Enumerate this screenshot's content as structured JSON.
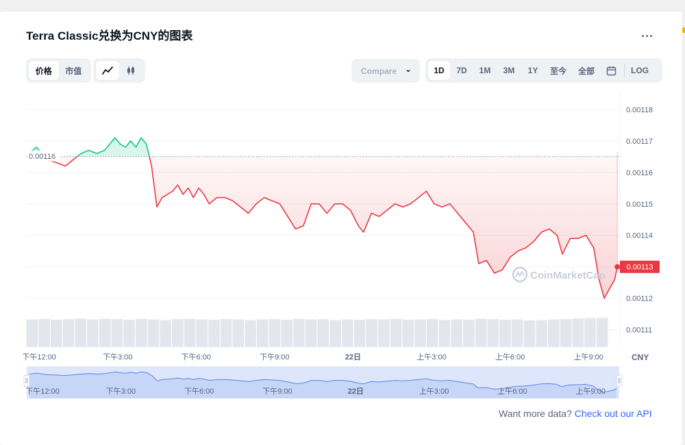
{
  "header": {
    "title": "Terra Classic兑换为CNY的图表",
    "more_label": "..."
  },
  "toolbar": {
    "view_tabs": [
      "价格",
      "市值"
    ],
    "chart_type_icons": [
      "line-chart-icon",
      "candlestick-icon"
    ],
    "compare_label": "Compare",
    "ranges": [
      "1D",
      "7D",
      "1M",
      "3M",
      "1Y",
      "至今",
      "全部"
    ],
    "active_range": "1D",
    "calendar_icon": "calendar-icon",
    "log_label": "LOG"
  },
  "watermark": "CoinMarketCap",
  "footer": {
    "text": "Want more data?",
    "link": "Check out our API"
  },
  "colors": {
    "up": "#16c784",
    "down": "#ea3943",
    "navigator": "#5b85e6"
  },
  "chart_data": {
    "type": "line",
    "currency_label": "CNY",
    "y_ticks": [
      "0.00118",
      "0.00117",
      "0.00116",
      "0.00115",
      "0.00114",
      "0.00113",
      "0.00112",
      "0.00111"
    ],
    "ylim": [
      0.0011045,
      0.001188
    ],
    "xlim": [
      0,
      22.7
    ],
    "x_ticks": [
      {
        "x": 0.5,
        "label": "下午12:00"
      },
      {
        "x": 3.5,
        "label": "下午3:00"
      },
      {
        "x": 6.5,
        "label": "下午6:00"
      },
      {
        "x": 9.5,
        "label": "下午9:00"
      },
      {
        "x": 12.5,
        "label": "22日"
      },
      {
        "x": 15.5,
        "label": "上午3:00"
      },
      {
        "x": 18.5,
        "label": "上午6:00"
      },
      {
        "x": 21.5,
        "label": "上午9:00"
      }
    ],
    "navigator_ticks": [
      "下午12:00",
      "下午3:00",
      "下午6:00",
      "下午9:00",
      "22日",
      "上午3:00",
      "上午6:00",
      "上午9:00"
    ],
    "open_price": 0.001165,
    "open_price_label": "0.00116",
    "current_price": 0.00113,
    "current_price_label": "0.00113",
    "series": [
      {
        "values": [
          [
            0.1,
            0.001166
          ],
          [
            0.4,
            0.001168
          ],
          [
            0.8,
            0.001164
          ],
          [
            1.2,
            0.001163
          ],
          [
            1.5,
            0.001162
          ],
          [
            1.8,
            0.001164
          ],
          [
            2.1,
            0.001166
          ],
          [
            2.4,
            0.001167
          ],
          [
            2.7,
            0.001166
          ],
          [
            3.0,
            0.001167
          ],
          [
            3.2,
            0.001169
          ],
          [
            3.4,
            0.001171
          ],
          [
            3.6,
            0.001169
          ],
          [
            3.8,
            0.001168
          ],
          [
            4.0,
            0.00117
          ],
          [
            4.2,
            0.001168
          ],
          [
            4.4,
            0.001171
          ],
          [
            4.6,
            0.001169
          ],
          [
            4.8,
            0.001162
          ],
          [
            5.0,
            0.001149
          ],
          [
            5.2,
            0.001152
          ],
          [
            5.4,
            0.001153
          ],
          [
            5.6,
            0.001154
          ],
          [
            5.8,
            0.001156
          ],
          [
            6.0,
            0.001153
          ],
          [
            6.2,
            0.001155
          ],
          [
            6.4,
            0.001152
          ],
          [
            6.6,
            0.001155
          ],
          [
            6.8,
            0.001153
          ],
          [
            7.0,
            0.00115
          ],
          [
            7.3,
            0.001152
          ],
          [
            7.6,
            0.001152
          ],
          [
            7.9,
            0.001151
          ],
          [
            8.2,
            0.001149
          ],
          [
            8.5,
            0.001147
          ],
          [
            8.8,
            0.00115
          ],
          [
            9.1,
            0.001152
          ],
          [
            9.4,
            0.001151
          ],
          [
            9.7,
            0.00115
          ],
          [
            10.0,
            0.001146
          ],
          [
            10.3,
            0.001142
          ],
          [
            10.6,
            0.001143
          ],
          [
            10.9,
            0.00115
          ],
          [
            11.2,
            0.00115
          ],
          [
            11.5,
            0.001147
          ],
          [
            11.8,
            0.00115
          ],
          [
            12.1,
            0.00115
          ],
          [
            12.4,
            0.001148
          ],
          [
            12.7,
            0.001143
          ],
          [
            12.9,
            0.001141
          ],
          [
            13.2,
            0.001147
          ],
          [
            13.5,
            0.001146
          ],
          [
            13.8,
            0.001148
          ],
          [
            14.1,
            0.00115
          ],
          [
            14.4,
            0.001149
          ],
          [
            14.7,
            0.00115
          ],
          [
            15.0,
            0.001152
          ],
          [
            15.3,
            0.001154
          ],
          [
            15.6,
            0.00115
          ],
          [
            15.9,
            0.001149
          ],
          [
            16.2,
            0.00115
          ],
          [
            16.5,
            0.001147
          ],
          [
            16.8,
            0.001144
          ],
          [
            17.1,
            0.001141
          ],
          [
            17.3,
            0.001131
          ],
          [
            17.6,
            0.001132
          ],
          [
            17.9,
            0.001128
          ],
          [
            18.2,
            0.001129
          ],
          [
            18.5,
            0.001133
          ],
          [
            18.8,
            0.001135
          ],
          [
            19.1,
            0.001136
          ],
          [
            19.4,
            0.001138
          ],
          [
            19.7,
            0.001141
          ],
          [
            20.0,
            0.001142
          ],
          [
            20.3,
            0.00114
          ],
          [
            20.5,
            0.001134
          ],
          [
            20.8,
            0.001139
          ],
          [
            21.1,
            0.001139
          ],
          [
            21.4,
            0.00114
          ],
          [
            21.7,
            0.001136
          ],
          [
            21.9,
            0.001126
          ],
          [
            22.1,
            0.00112
          ],
          [
            22.3,
            0.001123
          ],
          [
            22.5,
            0.001126
          ],
          [
            22.6,
            0.00113
          ]
        ]
      }
    ],
    "volume": [
      0.0011133,
      0.0011135,
      0.0011132,
      0.0011134,
      0.0011136,
      0.0011133,
      0.0011135,
      0.0011134,
      0.0011132,
      0.0011135,
      0.0011133,
      0.0011131,
      0.0011134,
      0.0011135,
      0.0011133,
      0.0011132,
      0.0011134,
      0.0011133,
      0.0011131,
      0.0011133,
      0.0011134,
      0.0011132,
      0.0011135,
      0.0011133,
      0.0011134,
      0.0011131,
      0.0011133,
      0.0011132,
      0.0011134,
      0.0011133,
      0.0011135,
      0.0011132,
      0.0011133,
      0.0011134,
      0.0011131,
      0.0011133,
      0.0011132,
      0.0011135,
      0.0011134,
      0.0011132,
      0.0011133,
      0.001113,
      0.0011131,
      0.0011133,
      0.0011134,
      0.0011136,
      0.0011137,
      0.0011138
    ]
  }
}
